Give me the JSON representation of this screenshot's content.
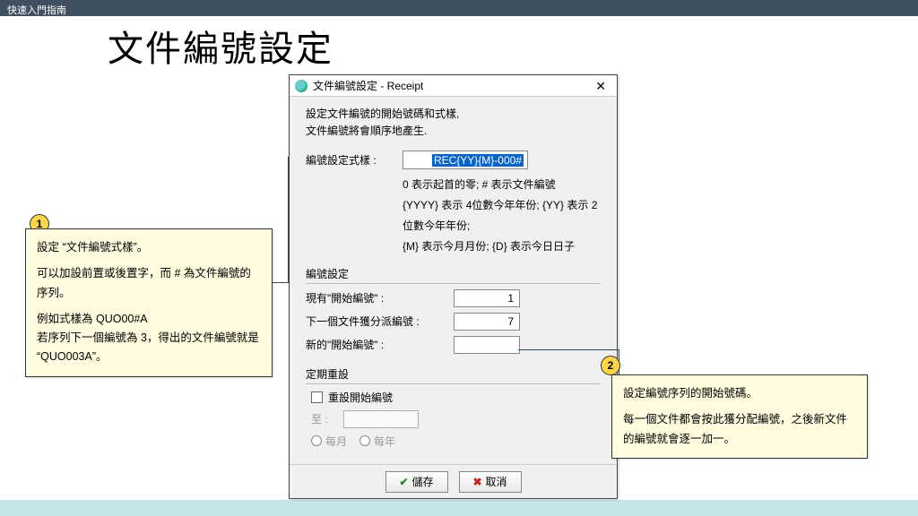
{
  "header": {
    "guide": "快速入門指南"
  },
  "page": {
    "title": "文件編號設定"
  },
  "dialog": {
    "title": "文件編號設定 - Receipt",
    "desc1": "設定文件編號的開始號碼和式樣,",
    "desc2": "文件編號將會順序地產生.",
    "pattern_label": "編號設定式樣  :",
    "pattern_value": "REC{YY}{M}-000#",
    "hint1": "0 表示起首的零; # 表示文件編號",
    "hint2": "{YYYY} 表示 4位數今年年份; {YY} 表示 2位數今年年份;",
    "hint3": "{M} 表示今月月份; {D} 表示今日日子",
    "group_numbering": "編號設定",
    "current_start_label": "現有\"開始編號\"  :",
    "current_start_value": "1",
    "next_assign_label": "下一個文件獲分派編號  :",
    "next_assign_value": "7",
    "new_start_label": "新的\"開始編號\"  :",
    "new_start_value": "",
    "group_reset": "定期重設",
    "reset_chk_label": "重設開始編號",
    "to_label": "至  :",
    "period_monthly": "每月",
    "period_yearly": "每年",
    "btn_save": "儲存",
    "btn_cancel": "取消"
  },
  "callouts": {
    "c1_badge": "1",
    "c1_l1": "設定 “文件編號式樣”。",
    "c1_l2": "可以加設前置或後置字，而 # 為文件編號的序列。",
    "c1_l3": "例如式樣為 QUO00#A",
    "c1_l4": "若序列下一個編號為 3，得出的文件編號就是 “QUO003A”。",
    "c2_badge": "2",
    "c2_l1": "設定編號序列的開始號碼。",
    "c2_l2": "每一個文件都會按此獲分配編號，之後新文件的編號就會逐一加一。"
  }
}
